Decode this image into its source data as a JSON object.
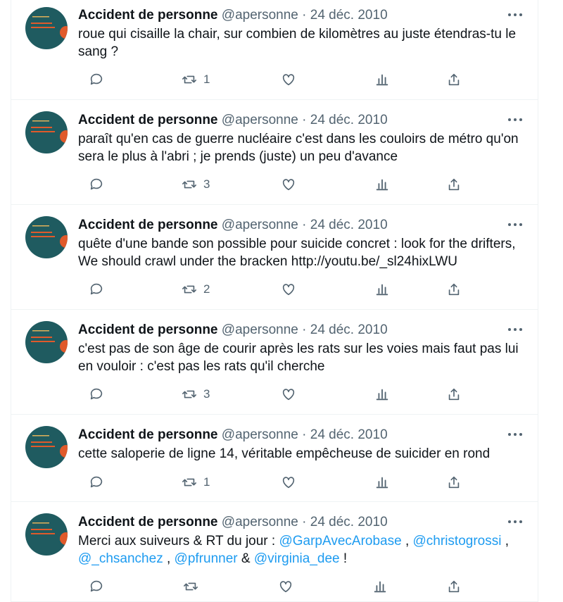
{
  "icons": {
    "more": "more-horizontal-icon",
    "reply": "reply-icon",
    "retweet": "retweet-icon",
    "like": "like-icon",
    "views": "analytics-icon",
    "share": "share-icon"
  },
  "colors": {
    "text": "#0f1419",
    "muted": "#536471",
    "link": "#1d9bf0",
    "avatar_bg": "#1f5b60",
    "avatar_accent": "#e05a2b"
  },
  "tweets": [
    {
      "name": "Accident de personne",
      "handle": "@apersonne",
      "sep": "·",
      "date": "24 déc. 2010",
      "text": "roue qui cisaille la chair, sur combien de kilomètres au juste étendras-tu le sang ?",
      "retweets": "1"
    },
    {
      "name": "Accident de personne",
      "handle": "@apersonne",
      "sep": "·",
      "date": "24 déc. 2010",
      "text": "paraît qu'en cas de guerre nucléaire c'est dans les couloirs de métro qu'on sera le plus à l'abri ; je prends (juste) un peu d'avance",
      "retweets": "3"
    },
    {
      "name": "Accident de personne",
      "handle": "@apersonne",
      "sep": "·",
      "date": "24 déc. 2010",
      "text": "quête d'une bande son possible pour suicide concret : look for the drifters, We should crawl under the bracken http://youtu.be/_sl24hixLWU",
      "retweets": "2"
    },
    {
      "name": "Accident de personne",
      "handle": "@apersonne",
      "sep": "·",
      "date": "24 déc. 2010",
      "text": "c'est pas de son âge de courir après les rats sur les voies mais faut pas lui en vouloir : c'est pas les rats qu'il cherche",
      "retweets": "3"
    },
    {
      "name": "Accident de personne",
      "handle": "@apersonne",
      "sep": "·",
      "date": "24 déc. 2010",
      "text": "cette saloperie de ligne 14, véritable empêcheuse de suicider en rond",
      "retweets": "1"
    },
    {
      "name": "Accident de personne",
      "handle": "@apersonne",
      "sep": "·",
      "date": "24 déc. 2010",
      "text_parts": {
        "lead": "Merci aux suiveurs & RT du jour : ",
        "m1": "@GarpAvecArobase",
        "c1": " , ",
        "m2": "@christogrossi",
        "c2": " , ",
        "m3": "@_chsanchez",
        "c3": " ,  ",
        "m4": "@pfrunner",
        "c4": " & ",
        "m5": "@virginia_dee",
        "c5": "  !"
      },
      "retweets": ""
    }
  ]
}
